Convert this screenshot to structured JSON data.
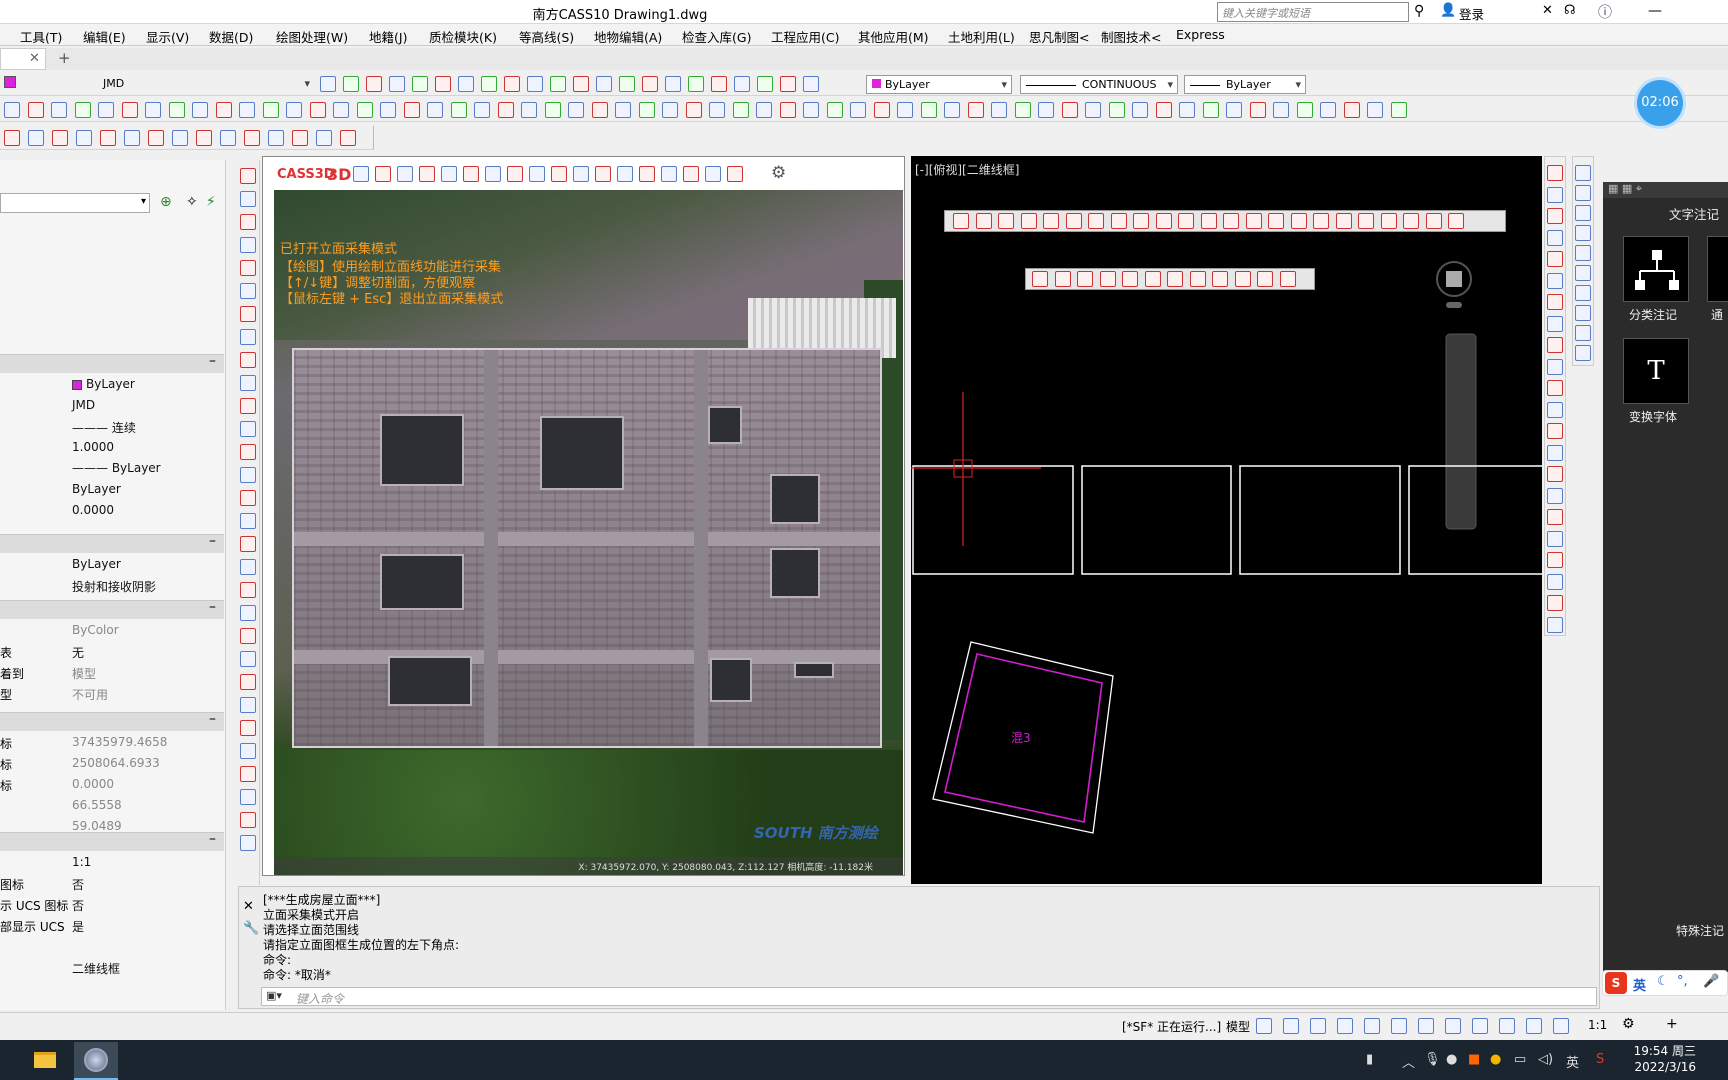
{
  "window": {
    "title": "南方CASS10    Drawing1.dwg",
    "search_placeholder": "键入关键字或短语",
    "login": "登录"
  },
  "menu": [
    "工具(T)",
    "编辑(E)",
    "显示(V)",
    "数据(D)",
    "绘图处理(W)",
    "地籍(J)",
    "质检模块(K)",
    "等高线(S)",
    "地物编辑(A)",
    "检查入库(G)",
    "工程应用(C)",
    "其他应用(M)",
    "土地利用(L)",
    "思凡制图<",
    "制图技术<",
    "Express"
  ],
  "toolbar": {
    "layer": "JMD",
    "color_combo": "ByLayer",
    "linetype_combo": "CONTINUOUS",
    "lineweight_combo": "ByLayer"
  },
  "timer": "02:06",
  "properties": {
    "rows_general": [
      {
        "k": "",
        "v": "ByLayer"
      },
      {
        "k": "",
        "v": "JMD"
      },
      {
        "k": "",
        "v": "——— 连续"
      },
      {
        "k": "",
        "v": "1.0000"
      },
      {
        "k": "",
        "v": "——— ByLayer"
      },
      {
        "k": "",
        "v": "ByLayer"
      },
      {
        "k": "",
        "v": "0.0000"
      }
    ],
    "rows_3d": [
      {
        "k": "",
        "v": "ByLayer"
      },
      {
        "k": "",
        "v": "投射和接收阴影"
      }
    ],
    "rows_plot": [
      {
        "k": "",
        "v": "ByColor"
      },
      {
        "k": "表",
        "v": "无"
      },
      {
        "k": "着到",
        "v": "模型"
      },
      {
        "k": "型",
        "v": "不可用"
      }
    ],
    "rows_view": [
      {
        "k": "标",
        "v": "37435979.4658"
      },
      {
        "k": "标",
        "v": "2508064.6933"
      },
      {
        "k": "标",
        "v": "0.0000"
      },
      {
        "k": "",
        "v": "66.5558"
      },
      {
        "k": "",
        "v": "59.0489"
      }
    ],
    "rows_misc": [
      {
        "k": "",
        "v": "1:1"
      },
      {
        "k": "图标",
        "v": "否"
      },
      {
        "k": "示 UCS 图标",
        "v": "否"
      },
      {
        "k": "部显示 UCS",
        "v": "是"
      },
      {
        "k": "",
        "v": ""
      },
      {
        "k": "",
        "v": "二维线框"
      }
    ]
  },
  "left_viewport": {
    "header": "CASS3D",
    "header_3d": "3D",
    "hint_lines": [
      "已打开立面采集模式",
      "【绘图】使用绘制立面线功能进行采集",
      "【↑/↓键】调整切割面，方便观察",
      "【鼠标左键 + Esc】退出立面采集模式"
    ],
    "coords": "X: 37435972.070, Y: 2508080.043, Z:112.127    相机高度: -11.182米",
    "watermark": "SOUTH 南方测绘"
  },
  "right_viewport": {
    "label": "[-][俯视][二维线框]",
    "building_label": "混3"
  },
  "right_panel": {
    "title": "文字注记",
    "items": [
      "分类注记",
      "通",
      "变换字体"
    ],
    "bottom": "特殊注记"
  },
  "command": {
    "lines": [
      "[***生成房屋立面***]",
      "立面采集模式开启",
      "请选择立面范围线",
      "请指定立面图框生成位置的左下角点:",
      "命令:",
      "命令: *取消*"
    ],
    "placeholder": "键入命令"
  },
  "status": {
    "running": "[*SF* 正在运行...]",
    "model": "模型",
    "scale": "1:1"
  },
  "ime": {
    "lang": "英"
  },
  "clock": {
    "time": "19:54 周三",
    "date": "2022/3/16"
  },
  "tray_lang": "英"
}
